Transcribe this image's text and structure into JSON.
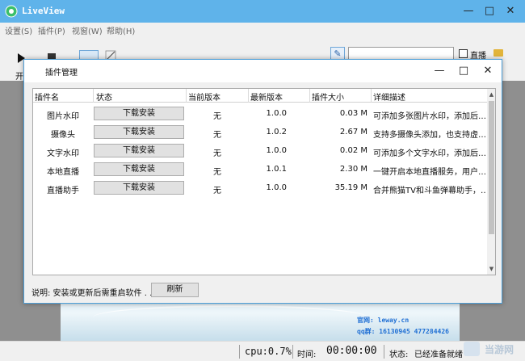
{
  "app": {
    "title": "LiveView",
    "menu": [
      "设置(S)",
      "插件(P)",
      "视窗(W)",
      "帮助(H)"
    ],
    "window_buttons": {
      "minimize": "—",
      "maximize": "□",
      "close": "✕"
    },
    "toolbar": {
      "start_label": "开",
      "live_label": "直播"
    },
    "preview": {
      "website": "官网: leway.cn",
      "qq": "qq群: 16130945  477284426"
    },
    "status": {
      "cpu": "cpu:0.7%",
      "time_label": "时间:",
      "time_value": "00:00:00",
      "status_label": "状态:",
      "status_value": "已经准备就绪"
    },
    "watermark": "当游网"
  },
  "dialog": {
    "title": "插件管理",
    "buttons": {
      "minimize": "—",
      "maximize": "□",
      "close": "✕"
    },
    "columns": [
      "插件名",
      "状态",
      "当前版本",
      "最新版本",
      "插件大小",
      "详细描述"
    ],
    "rows": [
      {
        "name": "图片水印",
        "action": "下载安装",
        "current": "无",
        "latest": "1.0.0",
        "size": "0.03 M",
        "desc": "可添加多张图片水印，添加后…"
      },
      {
        "name": "摄像头",
        "action": "下载安装",
        "current": "无",
        "latest": "1.0.2",
        "size": "2.67 M",
        "desc": "支持多摄像头添加，也支持虚…"
      },
      {
        "name": "文字水印",
        "action": "下载安装",
        "current": "无",
        "latest": "1.0.0",
        "size": "0.02 M",
        "desc": "可添加多个文字水印，添加后…"
      },
      {
        "name": "本地直播",
        "action": "下载安装",
        "current": "无",
        "latest": "1.0.1",
        "size": "2.30 M",
        "desc": "一键开启本地直播服务，用户…"
      },
      {
        "name": "直播助手",
        "action": "下载安装",
        "current": "无",
        "latest": "1.0.0",
        "size": "35.19 M",
        "desc": "合并熊猫TV和斗鱼弹幕助手，…"
      }
    ],
    "note": "说明: 安装或更新后需重启软件 . . .",
    "refresh_label": "刷新"
  }
}
